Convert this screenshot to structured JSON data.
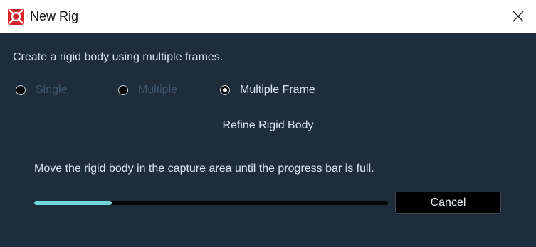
{
  "window": {
    "title": "New Rig",
    "app_icon": "motive-app-icon",
    "close_icon": "close-icon"
  },
  "dialog": {
    "description": "Create a rigid body using multiple frames.",
    "mode_options": [
      {
        "label": "Single",
        "selected": false,
        "enabled": false
      },
      {
        "label": "Multiple",
        "selected": false,
        "enabled": false
      },
      {
        "label": "Multiple Frame",
        "selected": true,
        "enabled": true
      }
    ],
    "section_heading": "Refine Rigid Body",
    "instruction": "Move the rigid body in the capture area until the progress bar is full.",
    "progress_fraction": 0.22,
    "cancel_label": "Cancel"
  },
  "colors": {
    "background": "#1f2c3b",
    "progress_fill": "#6fd8d6",
    "app_icon_red": "#d4262b"
  }
}
